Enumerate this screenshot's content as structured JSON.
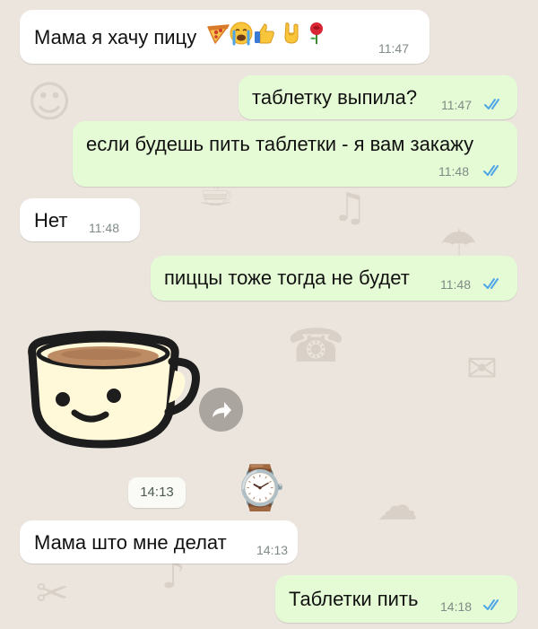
{
  "messages": [
    {
      "id": "m1",
      "side": "in",
      "text": "Мама я хачу пицу",
      "time": "11:47",
      "emojis": [
        "pizza-icon",
        "crying-face-icon",
        "thumbs-up-icon",
        "rock-hand-icon",
        "rose-icon"
      ]
    },
    {
      "id": "m2",
      "side": "out",
      "text": "таблетку выпила?",
      "time": "11:47",
      "status": "read"
    },
    {
      "id": "m3",
      "side": "out",
      "text": "если будешь пить таблетки - я вам закажу",
      "time": "11:48",
      "status": "read"
    },
    {
      "id": "m4",
      "side": "in",
      "text": "Нет",
      "time": "11:48"
    },
    {
      "id": "m5",
      "side": "out",
      "text": "пиццы тоже тогда не будет",
      "time": "11:48",
      "status": "read"
    },
    {
      "id": "m6",
      "side": "in",
      "sticker": "coffee-cup-sticker",
      "time": "14:13"
    },
    {
      "id": "m7",
      "side": "in",
      "text": "Мама што мне делат",
      "time": "14:13"
    },
    {
      "id": "m8",
      "side": "out",
      "text": "Таблетки пить",
      "time": "14:18",
      "status": "read"
    }
  ],
  "colors": {
    "wallpaper": "#ebe5de",
    "incoming_bubble": "#ffffff",
    "outgoing_bubble": "#e5fbd5",
    "read_ticks": "#4fa6e6",
    "timestamp": "#7f8b84"
  }
}
